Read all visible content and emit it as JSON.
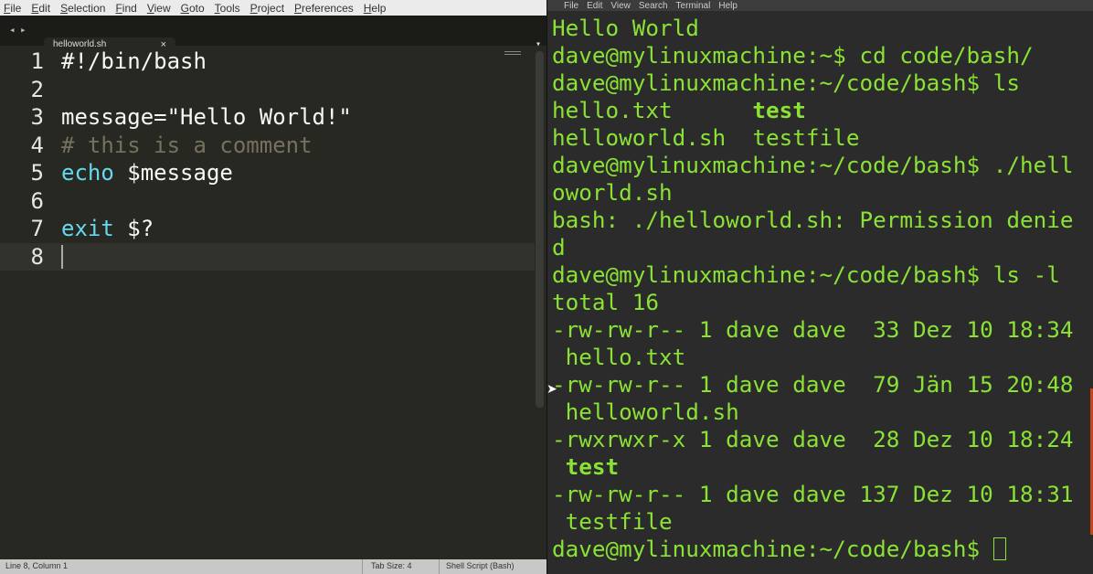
{
  "editor": {
    "menu": [
      "File",
      "Edit",
      "Selection",
      "Find",
      "View",
      "Goto",
      "Tools",
      "Project",
      "Preferences",
      "Help"
    ],
    "tab": {
      "title": "helloworld.sh",
      "close": "×",
      "prev": "◂",
      "next": "▸",
      "menu": "▾"
    },
    "lines": [
      {
        "number": "1",
        "segments": [
          {
            "t": "#!/bin/bash",
            "c": "txt"
          }
        ]
      },
      {
        "number": "2",
        "segments": []
      },
      {
        "number": "3",
        "segments": [
          {
            "t": "message=",
            "c": "txt"
          },
          {
            "t": "\"Hello World!\"",
            "c": "txt"
          }
        ]
      },
      {
        "number": "4",
        "segments": [
          {
            "t": "# this is a comment",
            "c": "cmt"
          }
        ]
      },
      {
        "number": "5",
        "segments": [
          {
            "t": "echo",
            "c": "kw"
          },
          {
            "t": " $message",
            "c": "txt"
          }
        ]
      },
      {
        "number": "6",
        "segments": []
      },
      {
        "number": "7",
        "segments": [
          {
            "t": "exit",
            "c": "kw"
          },
          {
            "t": " $?",
            "c": "txt"
          }
        ]
      },
      {
        "number": "8",
        "segments": [],
        "current": true
      }
    ],
    "status": {
      "position": "Line 8, Column 1",
      "tab_size": "Tab Size: 4",
      "syntax": "Shell Script (Bash)"
    }
  },
  "terminal": {
    "menu": [
      "File",
      "Edit",
      "View",
      "Search",
      "Terminal",
      "Help"
    ],
    "lines": [
      [
        {
          "t": "Hello World"
        }
      ],
      [
        {
          "t": "dave@mylinuxmachine:~$ cd code/bash/"
        }
      ],
      [
        {
          "t": "dave@mylinuxmachine:~/code/bash$ ls"
        }
      ],
      [
        {
          "t": "hello.txt      "
        },
        {
          "t": "test",
          "b": true
        }
      ],
      [
        {
          "t": "helloworld.sh  testfile"
        }
      ],
      [
        {
          "t": "dave@mylinuxmachine:~/code/bash$ ./hell"
        }
      ],
      [
        {
          "t": "oworld.sh"
        }
      ],
      [
        {
          "t": "bash: ./helloworld.sh: Permission denie"
        }
      ],
      [
        {
          "t": "d"
        }
      ],
      [
        {
          "t": "dave@mylinuxmachine:~/code/bash$ ls -l"
        }
      ],
      [
        {
          "t": "total 16"
        }
      ],
      [
        {
          "t": "-rw-rw-r-- 1 dave dave  33 Dez 10 18:34"
        }
      ],
      [
        {
          "t": " hello.txt"
        }
      ],
      [
        {
          "t": "-rw-rw-r-- 1 dave dave  79 Jän 15 20:48"
        }
      ],
      [
        {
          "t": " helloworld.sh"
        }
      ],
      [
        {
          "t": "-rwxrwxr-x 1 dave dave  28 Dez 10 18:24"
        }
      ],
      [
        {
          "t": " "
        },
        {
          "t": "test",
          "b": true
        }
      ],
      [
        {
          "t": "-rw-rw-r-- 1 dave dave 137 Dez 10 18:31"
        }
      ],
      [
        {
          "t": " testfile"
        }
      ],
      [
        {
          "t": "dave@mylinuxmachine:~/code/bash$ "
        }
      ]
    ],
    "cursor_on_last_line": true
  },
  "colors": {
    "editor_bg": "#272822",
    "terminal_bg": "#2b2b2b",
    "terminal_fg": "#8ae234",
    "keyword": "#66d9ef",
    "comment": "#75715e"
  },
  "icons": {
    "pointer": "mouse-pointer-icon",
    "tab_close": "close-icon",
    "tab_menu": "chevron-down-icon"
  }
}
